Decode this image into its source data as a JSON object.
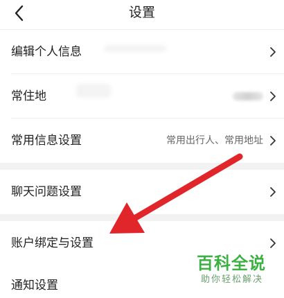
{
  "header": {
    "title": "设置",
    "back_icon": "chevron-left-icon"
  },
  "rows": [
    {
      "label": "编辑个人信息",
      "value": ""
    },
    {
      "label": "常住地",
      "value": ""
    },
    {
      "label": "常用信息设置",
      "value": "常用出行人、常用地址"
    },
    {
      "label": "聊天问题设置",
      "value": ""
    },
    {
      "label": "账户绑定与设置",
      "value": ""
    },
    {
      "label": "通知设置",
      "value": ""
    }
  ],
  "annotation": {
    "arrow_color": "#e0262b"
  },
  "watermark": {
    "title": "百科全说",
    "subtitle": "助你轻松解决",
    "color": "#3cb043"
  }
}
